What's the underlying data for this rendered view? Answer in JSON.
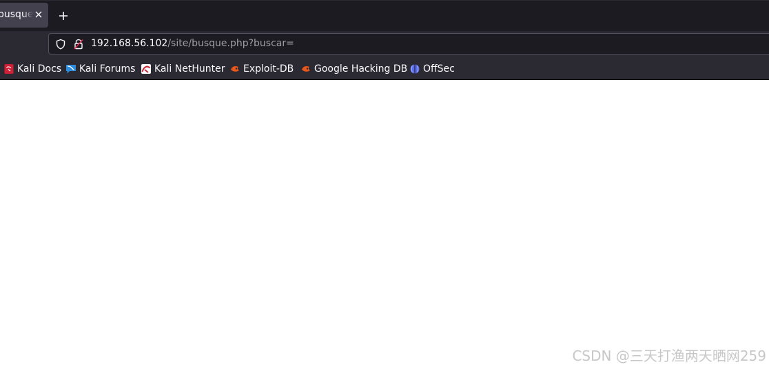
{
  "tab": {
    "title": "busque.php",
    "close_icon": "close-icon"
  },
  "new_tab_icon": "plus-icon",
  "urlbar": {
    "host": "192.168.56.102",
    "path": "/site/busque.php?buscar=",
    "shield_icon": "shield-icon",
    "lock_icon": "lock-icon"
  },
  "bookmarks": [
    {
      "label": "Kali Docs",
      "icon": "kali-docs-icon",
      "color": "#d02035"
    },
    {
      "label": "Kali Forums",
      "icon": "kali-forums-icon",
      "color": "#2f8bdc"
    },
    {
      "label": "Kali NetHunter",
      "icon": "kali-nethunter-icon",
      "color": "#c8283a"
    },
    {
      "label": "Exploit-DB",
      "icon": "exploit-db-icon",
      "color": "#e7561a"
    },
    {
      "label": "Google Hacking DB",
      "icon": "google-hacking-db-icon",
      "color": "#e7561a"
    },
    {
      "label": "OffSec",
      "icon": "offsec-icon",
      "color": "#5b6cf0"
    }
  ],
  "watermark": "CSDN @三天打渔两天晒网259"
}
